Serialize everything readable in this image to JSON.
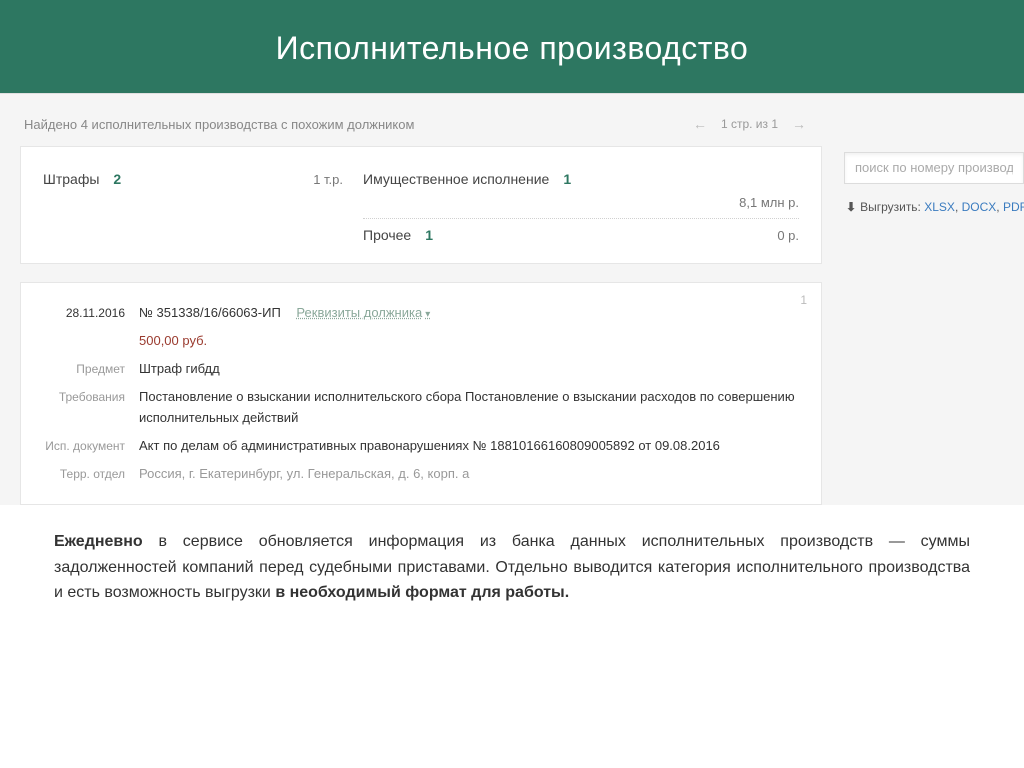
{
  "header": {
    "title": "Исполнительное производство"
  },
  "found_bar": {
    "text": "Найдено 4 исполнительных производства с похожим должником",
    "page_text": "1 стр. из 1"
  },
  "stats": {
    "fines": {
      "label": "Штрафы",
      "count": "2",
      "value": "1 т.р."
    },
    "property": {
      "label": "Имущественное исполнение",
      "count": "1",
      "value": "8,1 млн р."
    },
    "other": {
      "label": "Прочее",
      "count": "1",
      "value": "0 р."
    }
  },
  "search": {
    "placeholder": "поиск по номеру производства"
  },
  "export": {
    "label": "Выгрузить:",
    "xlsx": "XLSX",
    "docx": "DOCX",
    "pdf": "PDF"
  },
  "case": {
    "index": "1",
    "date": "28.11.2016",
    "number": "№ 351338/16/66063-ИП",
    "debtor_link": "Реквизиты должника",
    "amount": "500,00 руб.",
    "labels": {
      "subject": "Предмет",
      "demands": "Требования",
      "doc": "Исп. документ",
      "dept": "Терр. отдел"
    },
    "subject": "Штраф гибдд",
    "demands": "Постановление о взыскании исполнительского сбора Постановление о взыскании расходов по совершению исполнительных действий",
    "doc": "Акт по делам об административных правонарушениях № 18810166160809005892 от 09.08.2016",
    "dept": "Россия, г. Екатеринбург, ул. Генеральская, д. 6, корп. а"
  },
  "footer": {
    "bold1": "Ежедневно",
    "mid": " в сервисе обновляется информация из банка данных исполнительных производств — суммы задолженностей компаний перед судебными приставами. Отдельно выводится категория исполнительного производства и есть возможность выгрузки ",
    "bold2": "в необходимый формат для работы."
  }
}
